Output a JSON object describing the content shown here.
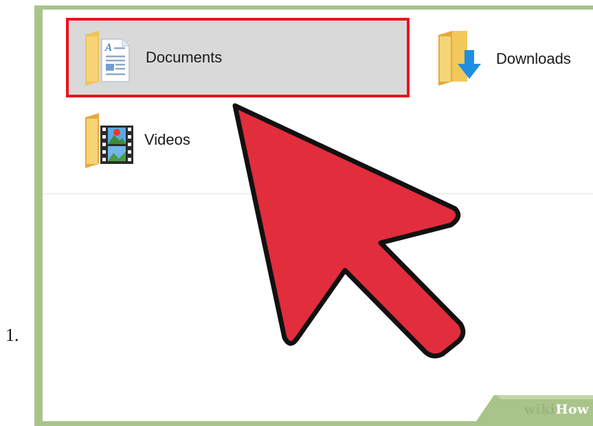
{
  "step": {
    "number": "1."
  },
  "folders": [
    {
      "label": "Documents",
      "icon": "documents-folder-icon",
      "selected": true
    },
    {
      "label": "Downloads",
      "icon": "downloads-folder-icon",
      "selected": false
    },
    {
      "label": "Videos",
      "icon": "videos-folder-icon",
      "selected": false
    }
  ],
  "watermark": {
    "part1": "wiki",
    "part2": "How"
  },
  "colors": {
    "frame": "#a9c48a",
    "selection_fill": "#d9d9d9",
    "selection_outline": "#e8141c",
    "arrow_fill": "#e12d3c",
    "folder_yellow": "#f3c85a",
    "download_blue": "#1e8fe1"
  }
}
